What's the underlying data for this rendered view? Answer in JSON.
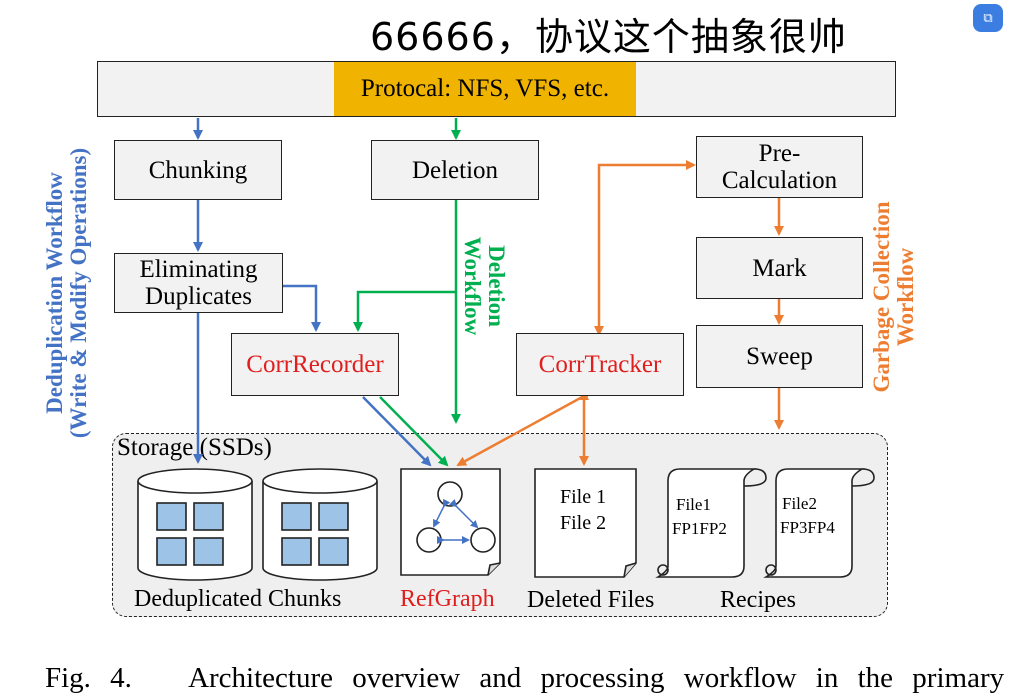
{
  "banner_text": "66666，协议这个抽象很帅",
  "protocol_label": "Protocal: NFS, VFS, etc.",
  "nodes": {
    "chunking": "Chunking",
    "eliminating": [
      "Eliminating",
      "Duplicates"
    ],
    "deletion": "Deletion",
    "corr_recorder": "CorrRecorder",
    "corr_tracker": "CorrTracker",
    "pre_calc": [
      "Pre-",
      "Calculation"
    ],
    "mark": "Mark",
    "sweep": "Sweep"
  },
  "workflows": {
    "dedup": [
      "Deduplication Workflow",
      "(Write & Modify Operations)"
    ],
    "deletion": [
      "Deletion",
      "Workflow"
    ],
    "gc": [
      "Garbage Collection",
      "Workflow"
    ]
  },
  "storage": {
    "title": "Storage (SSDs)",
    "dedup_chunks": "Deduplicated Chunks",
    "refgraph": "RefGraph",
    "deleted_files": "Deleted Files",
    "recipes": "Recipes",
    "deleted_file_entries": [
      "File 1",
      "File 2"
    ],
    "recipe1": [
      "File1",
      "FP1FP2"
    ],
    "recipe2": [
      "File2",
      "FP3FP4"
    ]
  },
  "caption": "Fig. 4.   Architecture overview and processing workflow in the primary",
  "colors": {
    "blue": "#4472c4",
    "green": "#00b050",
    "orange": "#ed7d31",
    "protocol": "#f0b400",
    "red_text": "#e01e1e",
    "chunk_fill": "#9dc3e6",
    "box_fill": "#f2f2f2",
    "storage_fill": "#efefef"
  },
  "icons": [
    "translate-icon"
  ]
}
